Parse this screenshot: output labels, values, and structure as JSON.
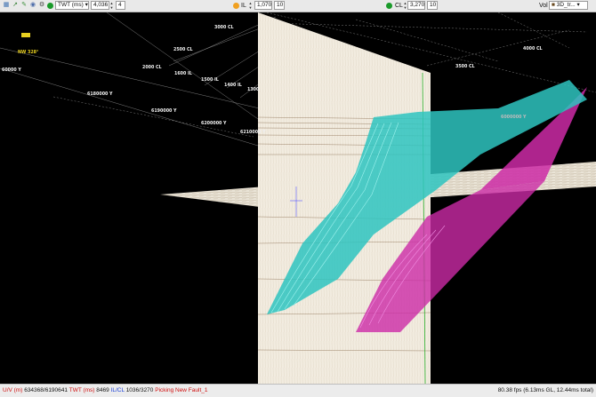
{
  "toolbar": {
    "domain_select": "TWT (ms)",
    "twt_value": "4,036",
    "twt_step": "4",
    "il_label": "IL",
    "il_value": "1,070",
    "il_step": "10",
    "cl_label": "CL",
    "cl_value": "3,270",
    "cl_step": "10",
    "vol_label": "Vol",
    "vol_select": "3D_tr..."
  },
  "scene": {
    "compass": "NW 328°",
    "cl_labels": [
      "3000 CL",
      "2500 CL",
      "2000 CL",
      "3500 CL",
      "4000 CL"
    ],
    "il_labels": [
      "1600 IL",
      "1500 IL",
      "1400 IL",
      "1300"
    ],
    "y_labels": [
      "6180000 Y",
      "6190000 Y",
      "6200000 Y",
      "6210000 Y"
    ],
    "side_y_label": "60000 Y",
    "right_label": "6000000 Y",
    "colors": {
      "fault_cyan": "#2ec4c0",
      "fault_magenta": "#cc2aa6",
      "seismic_bg": "#f6f0e2",
      "grid_line": "#dddddd"
    }
  },
  "status": {
    "uv_label": "U/V (m)",
    "uv_value": "634368/6190641",
    "twt_label": "TWT (ms)",
    "twt_value": "8469",
    "ilcl_label": "IL/CL",
    "ilcl_value": "1036/3270",
    "mode": "Picking New Fault_1",
    "fps": "80.38 fps (6.13ms GL, 12.44ms total)"
  }
}
